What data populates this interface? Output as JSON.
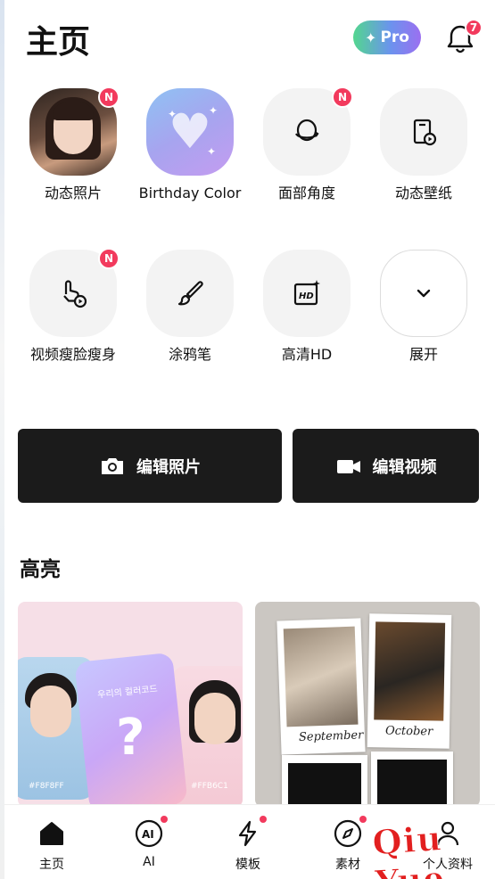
{
  "header": {
    "title": "主页",
    "pro_label": "Pro",
    "notification_count": "7"
  },
  "tools_row1": [
    {
      "label": "动态照片",
      "badge": "N"
    },
    {
      "label": "Birthday Color",
      "badge": ""
    },
    {
      "label": "面部角度",
      "badge": "N"
    },
    {
      "label": "动态壁纸",
      "badge": ""
    }
  ],
  "tools_row2": [
    {
      "label": "视频瘦脸瘦身",
      "badge": "N"
    },
    {
      "label": "涂鸦笔",
      "badge": ""
    },
    {
      "label": "高清HD",
      "badge": ""
    },
    {
      "label": "展开",
      "badge": ""
    }
  ],
  "actions": {
    "edit_photo": "编辑照片",
    "edit_video": "编辑视频"
  },
  "highlights": {
    "title": "高亮",
    "card1": {
      "korean_text": "우리의 컬러코드",
      "left_hex": "#F8F8FF",
      "right_hex": "#FFB6C1",
      "question": "?"
    },
    "card2": {
      "caption1": "September",
      "caption2": "October"
    }
  },
  "tabbar": [
    {
      "label": "主页"
    },
    {
      "label": "AI"
    },
    {
      "label": "模板"
    },
    {
      "label": "素材"
    },
    {
      "label": "个人资料"
    }
  ],
  "watermark": "Qiu Yue",
  "colors": {
    "accent_red": "#f23a5d",
    "button_dark": "#1b1b1b",
    "pro_gradient_start": "#53d68f",
    "pro_gradient_end": "#9b6ff0"
  }
}
